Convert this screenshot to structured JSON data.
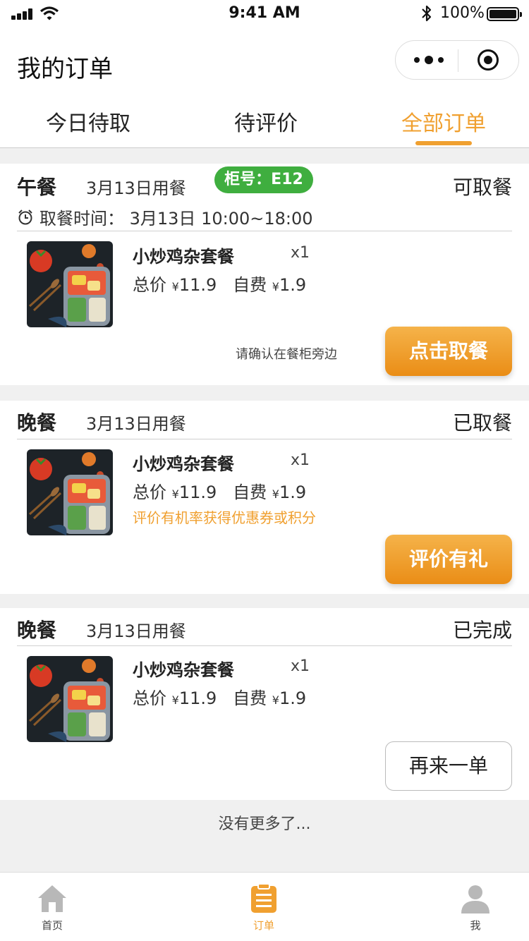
{
  "status_bar": {
    "time": "9:41 AM",
    "battery": "100%"
  },
  "page": {
    "title": "我的订单"
  },
  "tabs": [
    {
      "label": "今日待取",
      "active": false
    },
    {
      "label": "待评价",
      "active": false
    },
    {
      "label": "全部订单",
      "active": true
    }
  ],
  "orders": [
    {
      "meal": "午餐",
      "date": "3月13日用餐",
      "locker": "柜号：E12",
      "status": "可取餐",
      "pickup_time": "取餐时间：  3月13日  10:00~18:00",
      "item_name": "小炒鸡杂套餐",
      "qty": "x1",
      "total_label": "总价",
      "total": "11.9",
      "self_label": "自费",
      "self": "1.9",
      "note": "请确认在餐柜旁边",
      "button": "点击取餐"
    },
    {
      "meal": "晚餐",
      "date": "3月13日用餐",
      "status": "已取餐",
      "item_name": "小炒鸡杂套餐",
      "qty": "x1",
      "total_label": "总价",
      "total": "11.9",
      "self_label": "自费",
      "self": "1.9",
      "tip": "评价有机率获得优惠券或积分",
      "button": "评价有礼"
    },
    {
      "meal": "晚餐",
      "date": "3月13日用餐",
      "status": "已完成",
      "item_name": "小炒鸡杂套餐",
      "qty": "x1",
      "total_label": "总价",
      "total": "11.9",
      "self_label": "自费",
      "self": "1.9",
      "button": "再来一单"
    }
  ],
  "currency": "¥",
  "no_more": "没有更多了...",
  "tabbar": [
    {
      "label": "首页",
      "icon": "home-icon",
      "active": false
    },
    {
      "label": "订单",
      "icon": "clipboard-icon",
      "active": true
    },
    {
      "label": "我",
      "icon": "user-icon",
      "active": false
    }
  ],
  "colors": {
    "accent": "#f0a030",
    "locker_green": "#3fae3f"
  }
}
